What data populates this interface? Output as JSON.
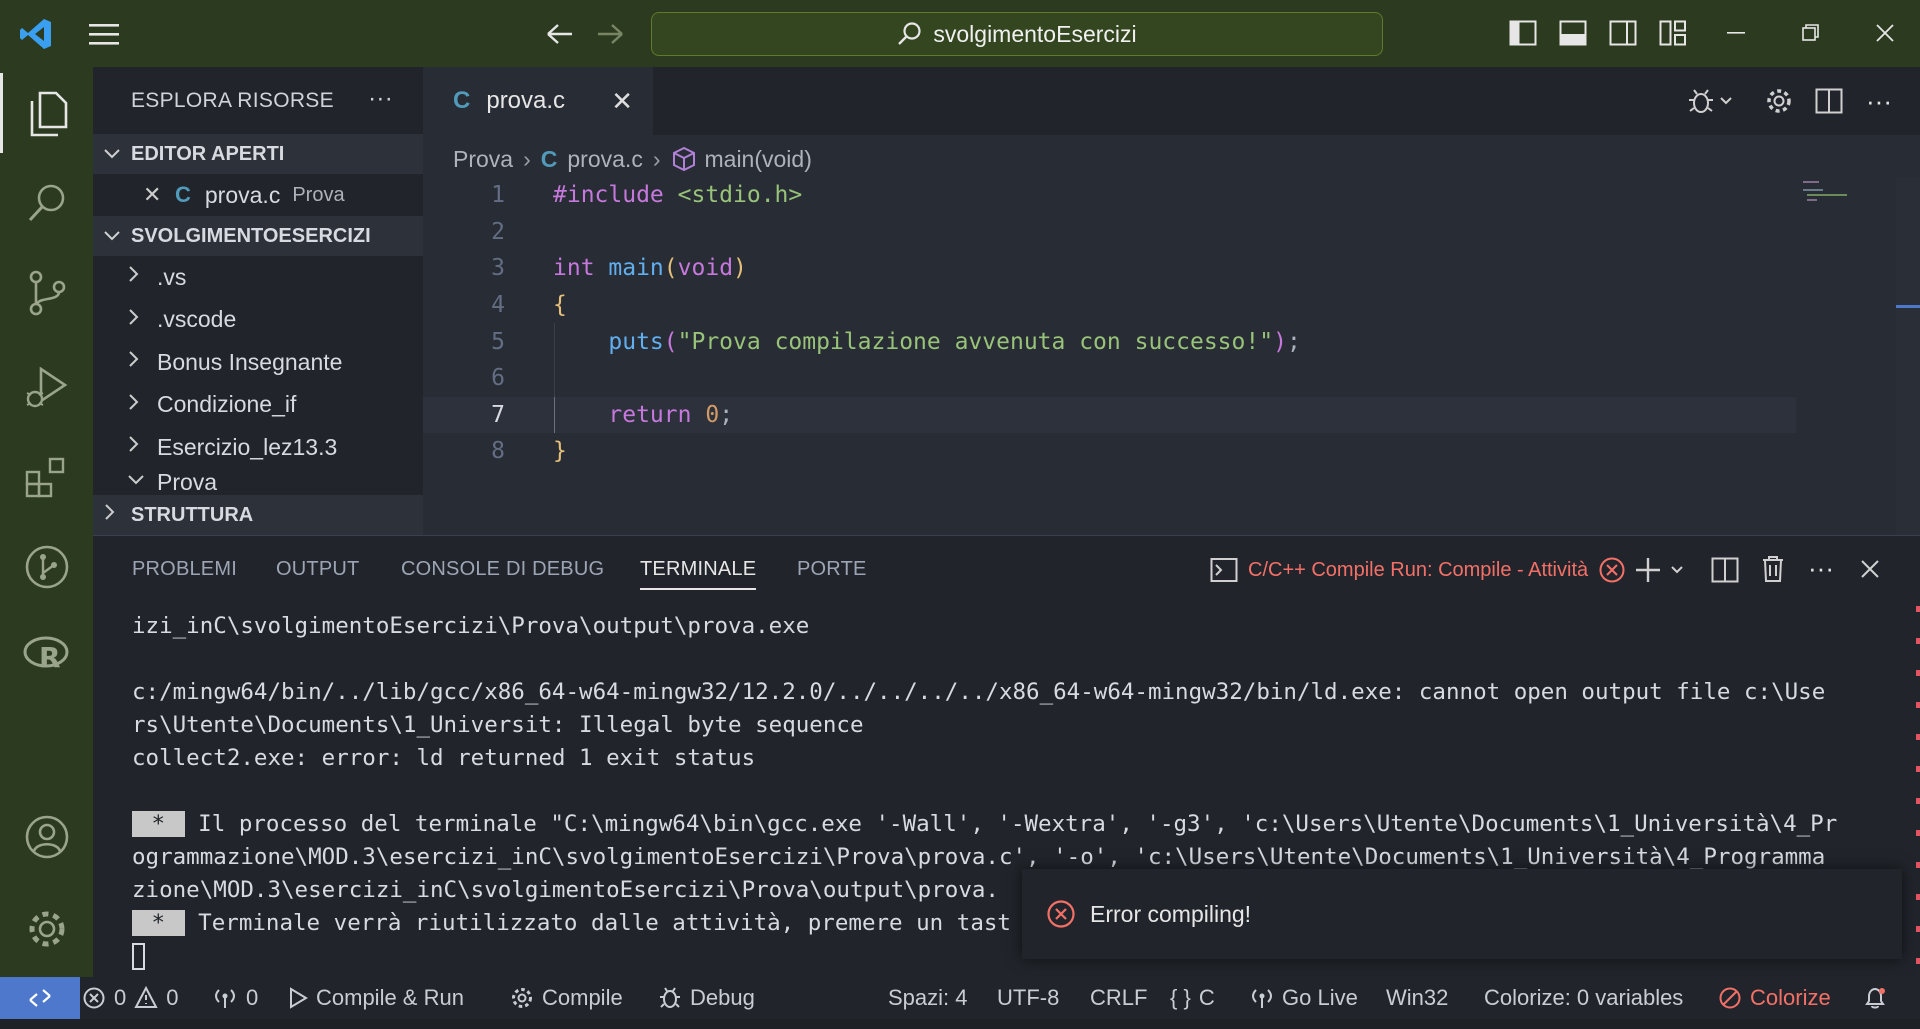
{
  "titlebar": {
    "search_text": "svolgimentoEsercizi"
  },
  "sidebar": {
    "title": "ESPLORA RISORSE",
    "more": "···",
    "open_editors_header": "EDITOR APERTI",
    "open_editor": {
      "icon_letter": "C",
      "name": "prova.c",
      "desc": "Prova"
    },
    "workspace_header": "SVOLGIMENTOESERCIZI",
    "items": [
      ".vs",
      ".vscode",
      "Bonus Insegnante",
      "Condizione_if",
      "Esercizio_lez13.3",
      "Prova"
    ],
    "outline_header": "STRUTTURA"
  },
  "editor": {
    "tab": {
      "icon_letter": "C",
      "name": "prova.c"
    },
    "breadcrumb": {
      "folder": "Prova",
      "file": "prova.c",
      "symbol": "main(void)"
    },
    "line_numbers": [
      "1",
      "2",
      "3",
      "4",
      "5",
      "6",
      "7",
      "8"
    ],
    "code": {
      "l1_include": "#include",
      "l1_header": " <stdio.h>",
      "l3_int": "int",
      "l3_main": " main",
      "l3_open": "(",
      "l3_void": "void",
      "l3_close": ")",
      "l4": "{",
      "l5_indent": "    ",
      "l5_fn": "puts",
      "l5_open": "(",
      "l5_str": "\"Prova compilazione avvenuta con successo!\"",
      "l5_close": ")",
      "l5_semi": ";",
      "l7_indent": "    ",
      "l7_return": "return",
      "l7_num": "0",
      "l7_semi": ";",
      "l8": "}"
    }
  },
  "panel": {
    "tabs": [
      "PROBLEMI",
      "OUTPUT",
      "CONSOLE DI DEBUG",
      "TERMINALE",
      "PORTE"
    ],
    "task_label": "C/C++ Compile Run: Compile - Attività",
    "terminal_lines": [
      "izi_inC\\svolgimentoEsercizi\\Prova\\output\\prova.exe",
      "",
      "c:/mingw64/bin/../lib/gcc/x86_64-w64-mingw32/12.2.0/../../../../x86_64-w64-mingw32/bin/ld.exe: cannot open output file c:\\Use",
      "rs\\Utente\\Documents\\1_Universit: Illegal byte sequence",
      "collect2.exe: error: ld returned 1 exit status",
      ""
    ],
    "star": " * ",
    "process_line_1": " Il processo del terminale \"C:\\mingw64\\bin\\gcc.exe '-Wall', '-Wextra', '-g3', 'c:\\Users\\Utente\\Documents\\1_Università\\4_Pr",
    "process_line_2": "ogrammazione\\MOD.3\\esercizi_inC\\svolgimentoEsercizi\\Prova\\prova.c', '-o', 'c:\\Users\\Utente\\Documents\\1_Università\\4_Programma",
    "process_line_3": "zione\\MOD.3\\esercizi_inC\\svolgimentoEsercizi\\Prova\\output\\prova.",
    "reuse_line": " Terminale verrà riutilizzato dalle attività, premere un tast"
  },
  "toast": {
    "message": "Error compiling!"
  },
  "statusbar": {
    "errors": "0",
    "warnings": "0",
    "ports": "0",
    "compile_run": "Compile & Run",
    "compile": "Compile",
    "debug": "Debug",
    "spaces": "Spazi: 4",
    "encoding": "UTF-8",
    "eol": "CRLF",
    "language": "C",
    "go_live": "Go Live",
    "platform": "Win32",
    "colorize_vars": "Colorize: 0 variables",
    "colorize": "Colorize"
  },
  "colors": {
    "accent": "#4d78cc",
    "titlebar": "#2c3b1f",
    "error": "#f47067"
  }
}
